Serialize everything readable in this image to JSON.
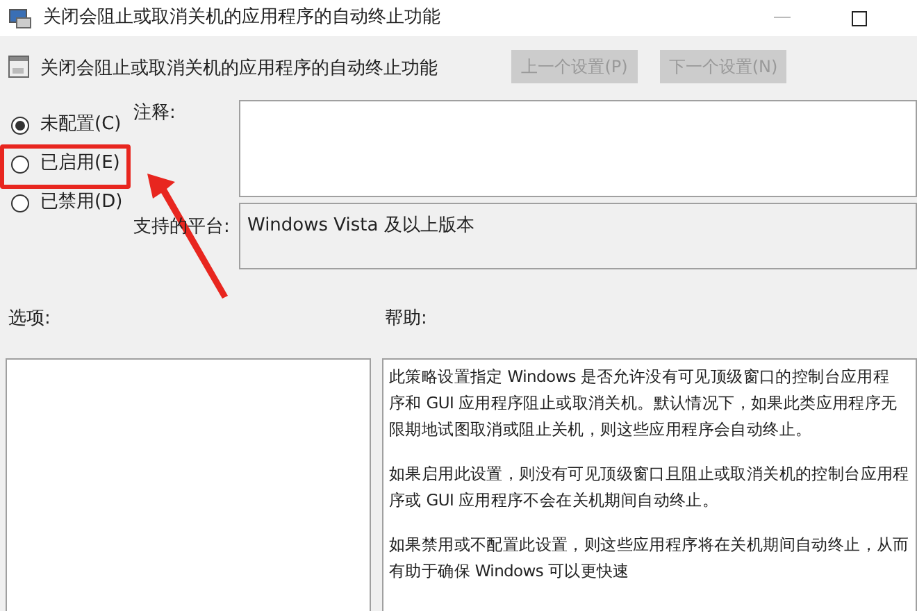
{
  "window": {
    "title": "关闭会阻止或取消关机的应用程序的自动终止功能"
  },
  "header": {
    "title": "关闭会阻止或取消关机的应用程序的自动终止功能",
    "buttons": [
      {
        "label": "上一个设置(P)",
        "disabled": true
      },
      {
        "label": "下一个设置(N)",
        "disabled": true
      }
    ]
  },
  "options": [
    {
      "label": "未配置(C)",
      "selected": true
    },
    {
      "label": "已启用(E)",
      "selected": false,
      "highlighted": true
    },
    {
      "label": "已禁用(D)",
      "selected": false
    }
  ],
  "comment": {
    "label": "注释:"
  },
  "supported_on": {
    "label": "支持的平台:",
    "value": "Windows Vista 及以上版本"
  },
  "options_panel": {
    "label": "选项:"
  },
  "help": {
    "label": "帮助:",
    "paragraphs": [
      [
        "此策略设置指定 Windows 是否允许没有可见顶级窗口的控制台应用程",
        "序和 GUI 应用程序阻止或取消关机。默认情况下，如果此类应用程序无",
        "限期地试图取消或阻止关机，则这些应用程序会自动终止。"
      ],
      [
        "如果启用此设置，则没有可见顶级窗口且阻止或取消关机的控制台应用程",
        "序或 GUI 应用程序不会在关机期间自动终止。"
      ],
      [
        "如果禁用或不配置此设置，则这些应用程序将在关机期间自动终止，从而",
        "有助于确保 Windows 可以更快速"
      ]
    ]
  }
}
